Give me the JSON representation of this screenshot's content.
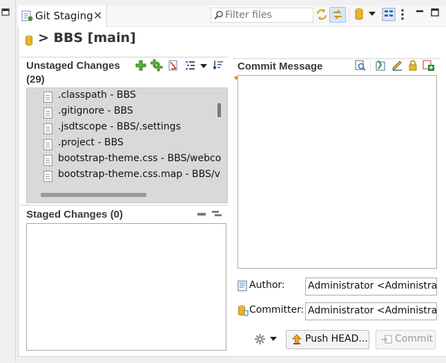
{
  "window": {
    "tab_title": "Git Staging",
    "tab_close": "✕",
    "filter_placeholder": "Filter files"
  },
  "repository": {
    "title": "> BBS [main]"
  },
  "unstaged": {
    "title": "Unstaged Changes",
    "count": "(29)",
    "files": [
      {
        "label": ".classpath - BBS"
      },
      {
        "label": ".gitignore - BBS"
      },
      {
        "label": ".jsdtscope - BBS/.settings"
      },
      {
        "label": ".project - BBS"
      },
      {
        "label": "bootstrap-theme.css - BBS/webco"
      },
      {
        "label": "bootstrap-theme.css.map - BBS/v"
      }
    ]
  },
  "staged": {
    "title": "Staged Changes (0)"
  },
  "commit": {
    "title": "Commit Message",
    "author_label": "Author:",
    "author_value": "Administrator <Administrat",
    "committer_label": "Committer:",
    "committer_value": "Administrator <Administrat",
    "push_label": "Push HEAD...",
    "commit_label": "Commit"
  },
  "colors": {
    "accent_green": "#3d9a2a",
    "cylinder_gold": "#e8b523",
    "list_selection": "#d9d9d9",
    "disabled_text": "#9a9a9a"
  }
}
